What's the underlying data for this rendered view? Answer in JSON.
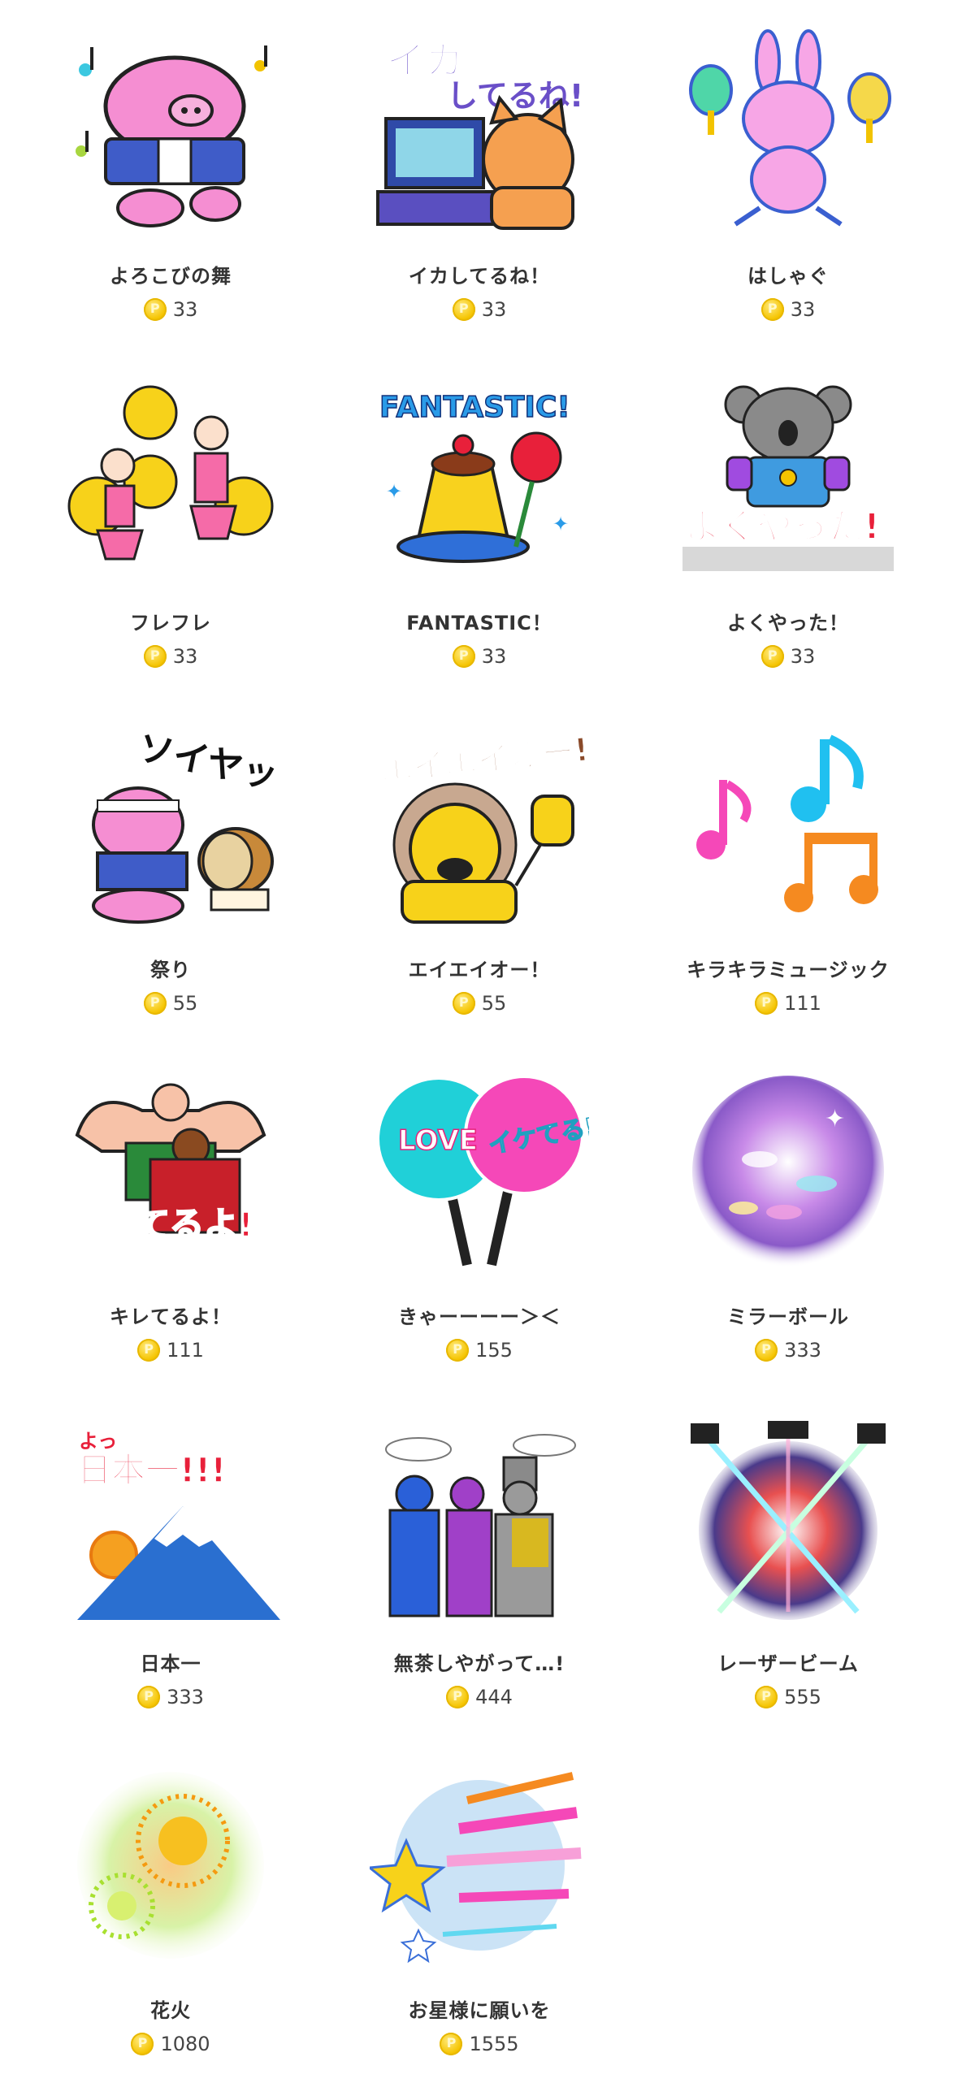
{
  "gifts": [
    {
      "name": "よろこびの舞",
      "price": "33",
      "icon": "dancing-pig-icon"
    },
    {
      "name": "イカしてるね！",
      "price": "33",
      "icon": "cat-squid-monitor-icon"
    },
    {
      "name": "はしゃぐ",
      "price": "33",
      "icon": "bunny-maracas-icon"
    },
    {
      "name": "フレフレ",
      "price": "33",
      "icon": "cheerleaders-icon"
    },
    {
      "name": "FANTASTIC！",
      "price": "33",
      "icon": "pudding-rose-icon"
    },
    {
      "name": "よくやった！",
      "price": "33",
      "icon": "koala-medal-icon"
    },
    {
      "name": "祭り",
      "price": "55",
      "icon": "festival-pig-drum-icon"
    },
    {
      "name": "エイエイオー！",
      "price": "55",
      "icon": "lion-fist-icon"
    },
    {
      "name": "キラキラミュージック",
      "price": "111",
      "icon": "music-notes-icon"
    },
    {
      "name": "キレてるよ！",
      "price": "111",
      "icon": "bodybuilders-icon"
    },
    {
      "name": "きゃーーーー＞＜",
      "price": "155",
      "icon": "fan-paddles-icon"
    },
    {
      "name": "ミラーボール",
      "price": "333",
      "icon": "mirror-ball-icon"
    },
    {
      "name": "日本一",
      "price": "333",
      "icon": "mount-fuji-icon"
    },
    {
      "name": "無茶しやがって…!",
      "price": "444",
      "icon": "saluting-trio-icon"
    },
    {
      "name": "レーザービーム",
      "price": "555",
      "icon": "laser-beam-icon"
    },
    {
      "name": "花火",
      "price": "1080",
      "icon": "fireworks-icon"
    },
    {
      "name": "お星様に願いを",
      "price": "1555",
      "icon": "shooting-star-icon"
    }
  ],
  "art_text": {
    "squid": "イカ",
    "squid2": "してるね!",
    "fantastic": "FANTASTIC!",
    "koala": "よくやった!",
    "festival": "ソイヤッ",
    "lion": "エイエイオー!",
    "muscle": "キレてるよ!",
    "love": "LOVE",
    "ikiteru": "イケてる!",
    "fuji_small": "よっ",
    "fuji": "日本一!!!"
  },
  "colors": {
    "coin": "#f5c400",
    "text": "#333333"
  }
}
